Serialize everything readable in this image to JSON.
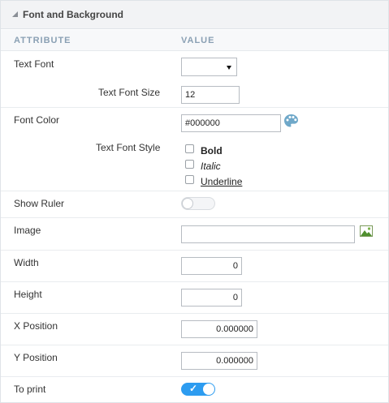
{
  "section": {
    "title": "Font and Background"
  },
  "columns": {
    "attribute": "ATTRIBUTE",
    "value": "VALUE"
  },
  "fields": {
    "text_font": {
      "label": "Text Font",
      "value": ""
    },
    "text_font_size": {
      "label": "Text Font Size",
      "value": "12"
    },
    "font_color": {
      "label": "Font Color",
      "value": "#000000"
    },
    "text_font_style": {
      "label": "Text Font Style",
      "options": [
        {
          "label": "Bold",
          "checked": false
        },
        {
          "label": "Italic",
          "checked": false
        },
        {
          "label": "Underline",
          "checked": false
        }
      ]
    },
    "show_ruler": {
      "label": "Show Ruler",
      "on": false
    },
    "image": {
      "label": "Image",
      "value": ""
    },
    "width": {
      "label": "Width",
      "value": "0"
    },
    "height": {
      "label": "Height",
      "value": "0"
    },
    "x_position": {
      "label": "X Position",
      "value": "0.000000"
    },
    "y_position": {
      "label": "Y Position",
      "value": "0.000000"
    },
    "to_print": {
      "label": "To print",
      "on": true
    }
  },
  "icons": {
    "palette": "palette-icon",
    "image_picker": "image-icon",
    "collapse": "collapse-triangle-icon"
  },
  "colors": {
    "accent": "#2d9cf0",
    "header_bg": "#f2f3f5",
    "column_header_text": "#8aa0b4"
  }
}
